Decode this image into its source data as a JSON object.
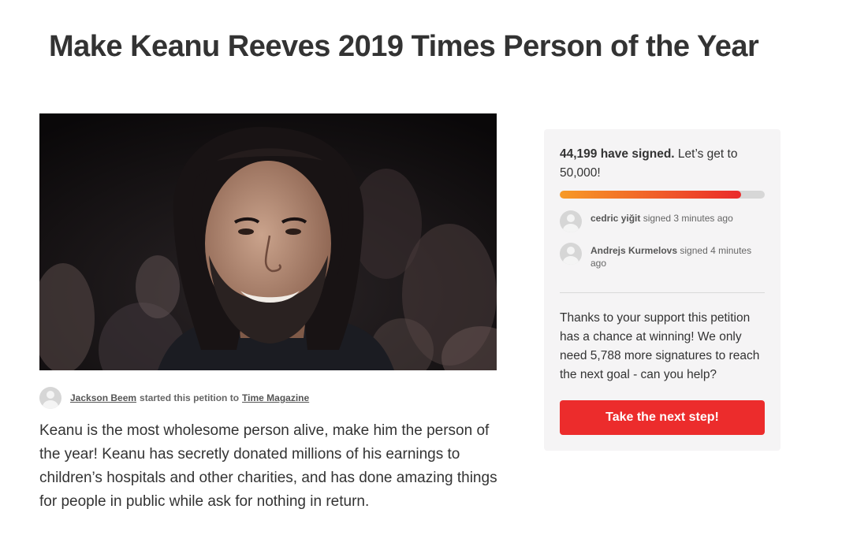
{
  "page_title": "Make Keanu Reeves 2019 Times Person of the Year",
  "petition": {
    "image_icon": "keanu-photo",
    "starter_name": "Jackson Beem",
    "starter_mid": "started this petition to",
    "target": "Time Magazine",
    "description": "Keanu is the most wholesome person alive, make him the person of the year! Keanu has secretly donated millions of his earnings to children’s hospitals and other charities, and has done amazing things for people in public while ask for nothing in return."
  },
  "sidebar": {
    "signed_count": "44,199 have signed.",
    "goal_text": " Let’s get to 50,000!",
    "progress": 0.884,
    "progress_colors": [
      "#f79a27",
      "#ea2b2b"
    ],
    "recent_signers": [
      {
        "name": "cedric yiğit",
        "action": " signed 3 minutes ago"
      },
      {
        "name": "Andrejs Kurmelovs",
        "action": " signed 4 minutes ago"
      }
    ],
    "support_text": "Thanks to your support this petition has a chance at winning! We only need 5,788 more signatures to reach the next goal - can you help?",
    "cta_label": "Take the next step!",
    "cta_color": "#ec2c2c"
  }
}
